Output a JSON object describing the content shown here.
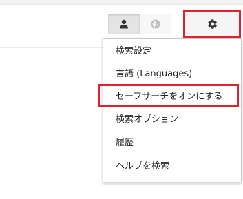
{
  "header": {
    "view_toggle": {
      "active": "person",
      "buttons": [
        {
          "icon": "person-icon"
        },
        {
          "icon": "globe-icon"
        }
      ]
    },
    "settings": {
      "icon": "gear-icon"
    }
  },
  "settings_menu": {
    "items": [
      {
        "label": "検索設定"
      },
      {
        "label": "言語 (Languages)"
      },
      {
        "label": "セーフサーチをオンにする"
      },
      {
        "label": "検索オプション"
      },
      {
        "label": "履歴"
      },
      {
        "label": "ヘルプを検索"
      }
    ]
  },
  "colors": {
    "highlight": "#dc2430",
    "icon": "#333333"
  }
}
